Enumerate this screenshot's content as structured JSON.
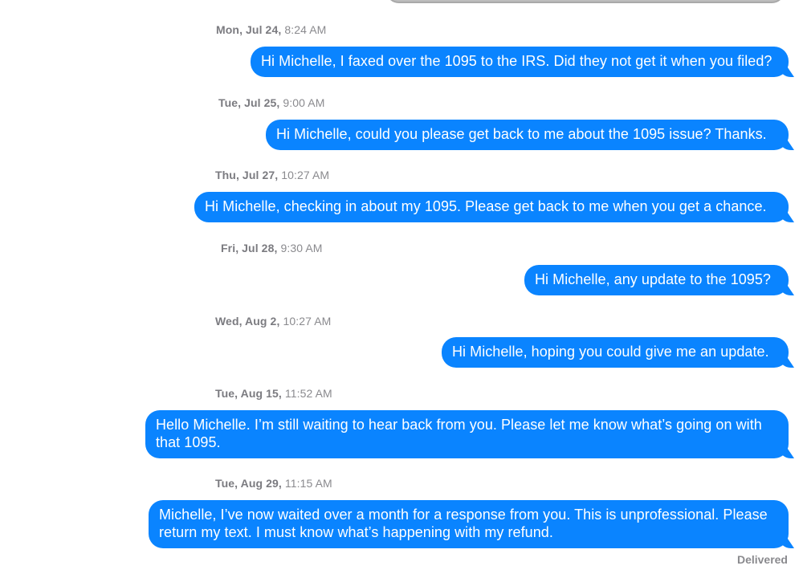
{
  "conversation": {
    "messages": [
      {
        "day": "Mon, Jul 24,",
        "time": "8:24 AM",
        "text": "Hi Michelle, I faxed over the 1095 to the IRS. Did they not get it when you filed?"
      },
      {
        "day": "Tue, Jul 25,",
        "time": "9:00 AM",
        "text": "Hi Michelle, could you please get back to me about the 1095 issue? Thanks."
      },
      {
        "day": "Thu, Jul 27,",
        "time": "10:27 AM",
        "text": "Hi Michelle, checking in about my 1095. Please get back to me when you get a chance."
      },
      {
        "day": "Fri, Jul 28,",
        "time": "9:30 AM",
        "text": "Hi Michelle, any update to the 1095?"
      },
      {
        "day": "Wed, Aug 2,",
        "time": "10:27 AM",
        "text": "Hi Michelle, hoping you could give me an update."
      },
      {
        "day": "Tue, Aug 15,",
        "time": "11:52 AM",
        "text": "Hello Michelle. I’m still waiting to hear back from you. Please let me know what’s going on with that 1095."
      },
      {
        "day": "Tue, Aug 29,",
        "time": "11:15 AM",
        "text": "Michelle, I’ve now waited over a month for a response from you. This is unprofessional. Please return my text. I must know what’s happening with my refund."
      }
    ],
    "status": "Delivered"
  },
  "colors": {
    "bubble": "#0a84ff",
    "bubble_text": "#ffffff",
    "timestamp": "#8a8a8e",
    "previous_bubble": "#bdbdbd"
  }
}
